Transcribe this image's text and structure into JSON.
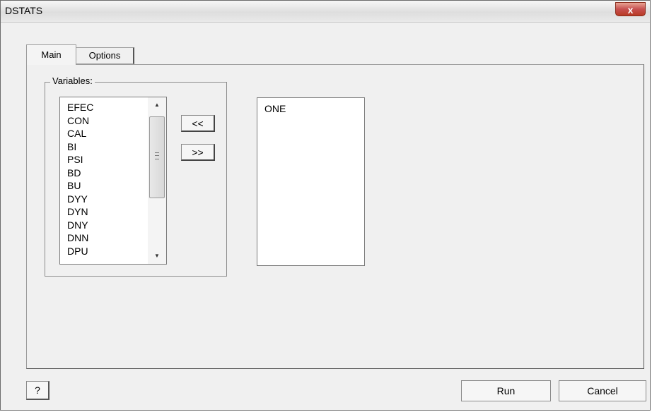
{
  "window": {
    "title": "DSTATS",
    "close_symbol": "x"
  },
  "tabs": [
    {
      "label": "Main"
    },
    {
      "label": "Options"
    }
  ],
  "variables_group": {
    "label": "Variables:",
    "items": [
      "EFEC",
      "CON",
      "CAL",
      "BI",
      "PSI",
      "BD",
      "BU",
      "DYY",
      "DYN",
      "DNY",
      "DNN",
      "DPU"
    ]
  },
  "move_buttons": {
    "add": "<<",
    "remove": ">>"
  },
  "selected_list": {
    "items": [
      "ONE"
    ]
  },
  "footer": {
    "help": "?",
    "run": "Run",
    "cancel": "Cancel"
  },
  "scrollbar": {
    "up_symbol": "▲",
    "down_symbol": "▼"
  }
}
